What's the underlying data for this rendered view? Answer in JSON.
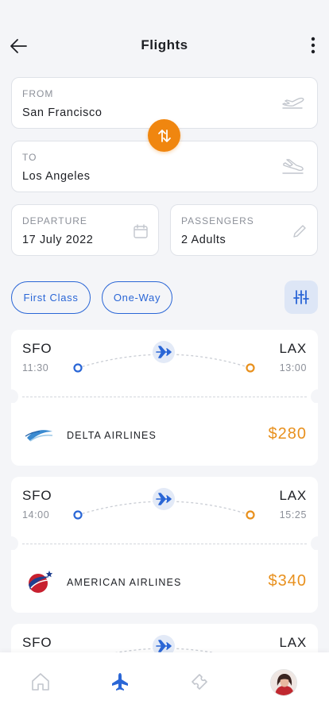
{
  "header": {
    "title": "Flights"
  },
  "search": {
    "from": {
      "label": "FROM",
      "value": "San Francisco"
    },
    "to": {
      "label": "TO",
      "value": "Los Angeles"
    },
    "departure": {
      "label": "DEPARTURE",
      "value": "17 July 2022"
    },
    "passengers": {
      "label": "PASSENGERS",
      "value": "2 Adults"
    }
  },
  "filters": {
    "class_label": "First Class",
    "trip_label": "One-Way"
  },
  "flights": [
    {
      "origin": "SFO",
      "destination": "LAX",
      "depart_time": "11:30",
      "arrive_time": "13:00",
      "airline": "DELTA AIRLINES",
      "price": "$280"
    },
    {
      "origin": "SFO",
      "destination": "LAX",
      "depart_time": "14:00",
      "arrive_time": "15:25",
      "airline": "AMERICAN AIRLINES",
      "price": "$340"
    },
    {
      "origin": "SFO",
      "destination": "LAX"
    }
  ],
  "colors": {
    "accent": "#2a66d6",
    "orange": "#f0860f",
    "price": "#e8901d"
  },
  "nav": {
    "items": [
      "home-icon",
      "plane-icon",
      "ticket-icon",
      "avatar"
    ]
  }
}
